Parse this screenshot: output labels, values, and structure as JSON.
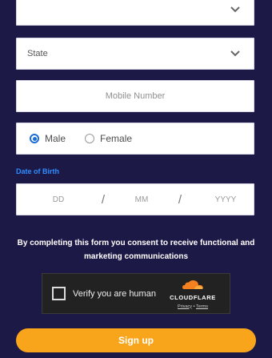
{
  "form": {
    "top_select": {
      "value": ""
    },
    "state": {
      "label": "State"
    },
    "mobile": {
      "placeholder": "Mobile Number"
    },
    "gender": {
      "options": [
        {
          "label": "Male",
          "selected": true
        },
        {
          "label": "Female",
          "selected": false
        }
      ]
    },
    "dob": {
      "label": "Date of Birth",
      "day_placeholder": "DD",
      "month_placeholder": "MM",
      "year_placeholder": "YYYY",
      "separator": "/"
    },
    "consent_text": "By completing this form you consent to receive functional and marketing communications",
    "captcha": {
      "label": "Verify you are human",
      "brand": "CLOUDFLARE",
      "privacy": "Privacy",
      "link_sep": "•",
      "terms": "Terms"
    },
    "submit_label": "Sign up"
  },
  "colors": {
    "background": "#1d1946",
    "accent_orange": "#f8a51c",
    "dob_label_blue": "#2f8dff",
    "radio_blue": "#1b6cd7"
  }
}
